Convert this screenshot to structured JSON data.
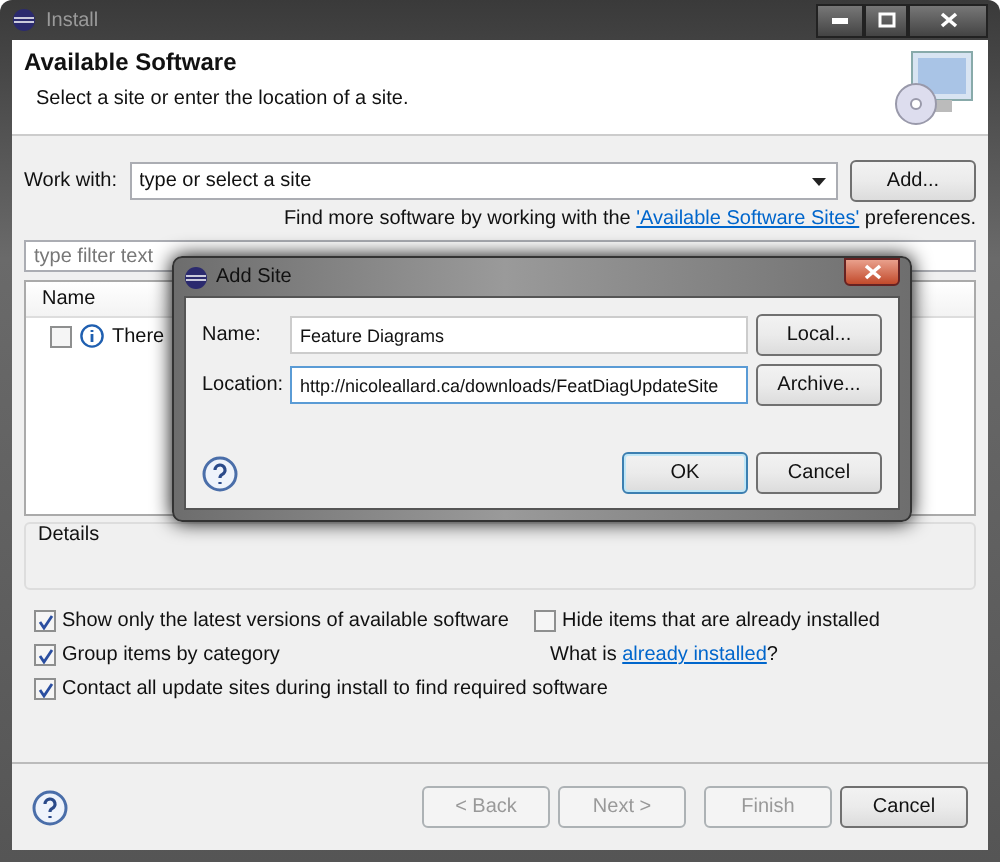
{
  "window": {
    "title": "Install"
  },
  "header": {
    "title": "Available Software",
    "subtitle": "Select a site or enter the location of a site."
  },
  "work_with": {
    "label": "Work with:",
    "value": "type or select a site",
    "add_button": "Add..."
  },
  "find_more": {
    "before": "Find more software by working with the ",
    "link": "'Available Software Sites'",
    "after": " preferences."
  },
  "filter": {
    "placeholder": "type filter text"
  },
  "table": {
    "columns": [
      "Name"
    ],
    "rows": [
      {
        "text": "There",
        "checked": false
      }
    ]
  },
  "details": {
    "label": "Details"
  },
  "options_left": [
    {
      "label": "Show only the latest versions of available software",
      "checked": true
    },
    {
      "label": "Group items by category",
      "checked": true
    },
    {
      "label": "Contact all update sites during install to find required software",
      "checked": true
    }
  ],
  "options_right": {
    "checkbox": {
      "label": "Hide items that are already installed",
      "checked": false
    },
    "question_before": "What is ",
    "question_link": "already installed",
    "question_after": "?"
  },
  "buttons": [
    {
      "label": "< Back",
      "disabled": true
    },
    {
      "label": "Next >",
      "disabled": true
    },
    {
      "label": "Finish",
      "disabled": true
    },
    {
      "label": "Cancel",
      "disabled": false
    }
  ],
  "dialog": {
    "title": "Add Site",
    "fields": [
      {
        "label": "Name:",
        "value": "Feature Diagrams",
        "button": "Local..."
      },
      {
        "label": "Location:",
        "value": "http://nicoleallard.ca/downloads/FeatDiagUpdateSite",
        "button": "Archive..."
      }
    ],
    "buttons": [
      {
        "label": "OK",
        "default": true
      },
      {
        "label": "Cancel",
        "default": false
      }
    ]
  }
}
